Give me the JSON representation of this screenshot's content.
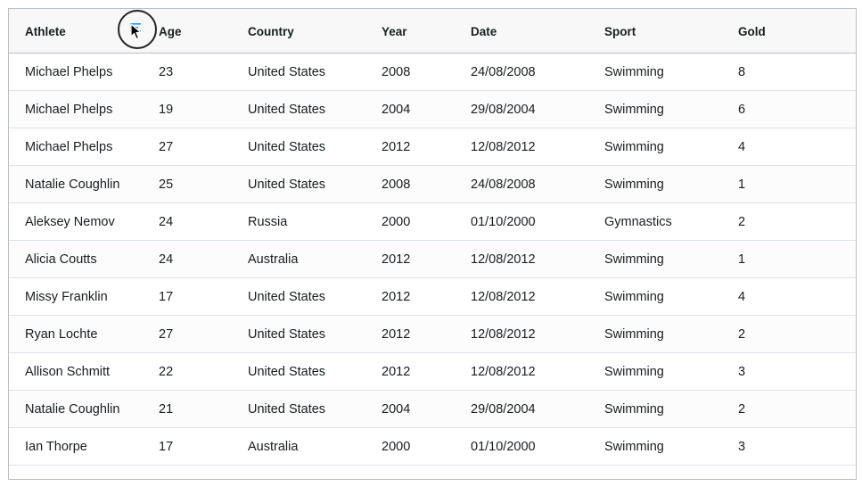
{
  "columns": [
    "Athlete",
    "Age",
    "Country",
    "Year",
    "Date",
    "Sport",
    "Gold"
  ],
  "header_menu_icon": "column-menu-icon",
  "rows": [
    [
      "Michael Phelps",
      "23",
      "United States",
      "2008",
      "24/08/2008",
      "Swimming",
      "8"
    ],
    [
      "Michael Phelps",
      "19",
      "United States",
      "2004",
      "29/08/2004",
      "Swimming",
      "6"
    ],
    [
      "Michael Phelps",
      "27",
      "United States",
      "2012",
      "12/08/2012",
      "Swimming",
      "4"
    ],
    [
      "Natalie Coughlin",
      "25",
      "United States",
      "2008",
      "24/08/2008",
      "Swimming",
      "1"
    ],
    [
      "Aleksey Nemov",
      "24",
      "Russia",
      "2000",
      "01/10/2000",
      "Gymnastics",
      "2"
    ],
    [
      "Alicia Coutts",
      "24",
      "Australia",
      "2012",
      "12/08/2012",
      "Swimming",
      "1"
    ],
    [
      "Missy Franklin",
      "17",
      "United States",
      "2012",
      "12/08/2012",
      "Swimming",
      "4"
    ],
    [
      "Ryan Lochte",
      "27",
      "United States",
      "2012",
      "12/08/2012",
      "Swimming",
      "2"
    ],
    [
      "Allison Schmitt",
      "22",
      "United States",
      "2012",
      "12/08/2012",
      "Swimming",
      "3"
    ],
    [
      "Natalie Coughlin",
      "21",
      "United States",
      "2004",
      "29/08/2004",
      "Swimming",
      "2"
    ],
    [
      "Ian Thorpe",
      "17",
      "Australia",
      "2000",
      "01/10/2000",
      "Swimming",
      "3"
    ]
  ],
  "colors": {
    "border": "#babfc7",
    "row_border": "#dde2eb",
    "header_bg": "#f8f8f8",
    "menu_icon": "#2196f3"
  }
}
